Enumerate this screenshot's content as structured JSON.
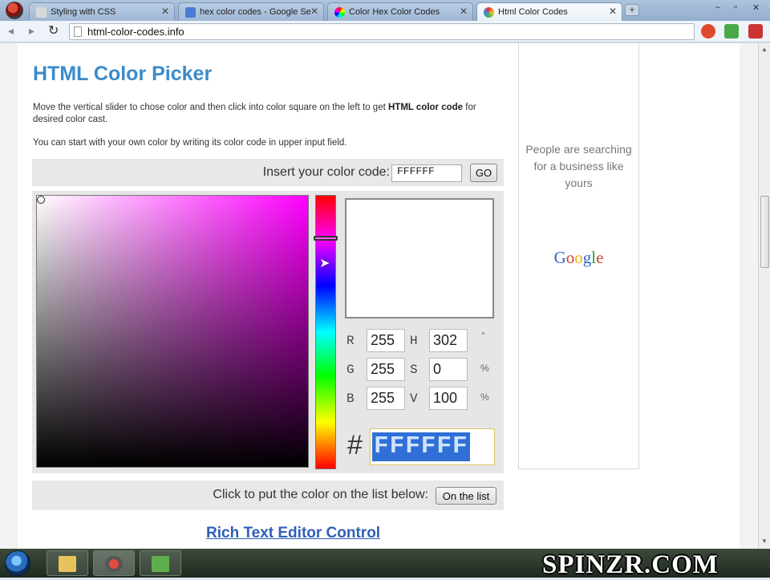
{
  "browser": {
    "tabs": [
      {
        "label": "Styling with CSS",
        "favicon_color": "#d9d9d9",
        "active": false
      },
      {
        "label": "hex color codes - Google Se",
        "favicon_color": "#4a7bd4",
        "active": false
      },
      {
        "label": "Color Hex Color Codes",
        "favicon_color": "#e05bd0",
        "active": false
      },
      {
        "label": "Html Color Codes",
        "favicon_color": "#e06b2a",
        "active": true
      }
    ],
    "new_tab_label": "+",
    "url": "html-color-codes.info"
  },
  "page": {
    "title": "HTML Color Picker",
    "intro_part1": "Move the vertical slider to chose color and then click into color square on the left to get ",
    "intro_bold": "HTML color code",
    "intro_part2": " for desired color cast.",
    "intro2": "You can start with your own color by writing its color code in upper input field.",
    "insert_label": "Insert your color code:",
    "input_value": "FFFFFF",
    "go_label": "GO",
    "r_label": "R",
    "r_value": "255",
    "g_label": "G",
    "g_value": "255",
    "b_label": "B",
    "b_value": "255",
    "h_label": "H",
    "h_value": "302",
    "h_unit": "°",
    "s_label": "S",
    "s_value": "0",
    "s_unit": "%",
    "v_label": "V",
    "v_value": "100",
    "v_unit": "%",
    "hash": "#",
    "hex_value": "FFFFFF",
    "list_label": "Click to put the color on the list below:",
    "list_button": "On the list",
    "rte_link": "Rich Text Editor Control",
    "colors": {
      "hue": "#ff00ff",
      "title": "#3b8bc9",
      "link": "#2f5fb8",
      "selection": "#2f6fd6"
    }
  },
  "ad": {
    "text": "People are searching for a business like yours",
    "logo_letters": [
      "G",
      "o",
      "o",
      "g",
      "l",
      "e"
    ]
  },
  "taskbar": {
    "apps": [
      "explorer-icon",
      "browser-icon",
      "spreadsheet-icon"
    ]
  },
  "watermark": "SPINZR.COM"
}
